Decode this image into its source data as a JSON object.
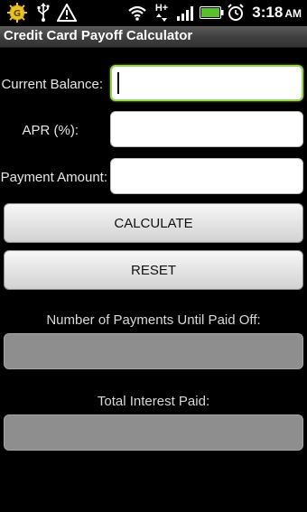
{
  "status_bar": {
    "time": "3:18",
    "ampm": "AM",
    "icons": [
      "htc-sense-icon",
      "usb-icon",
      "warning-icon",
      "wifi-icon",
      "hplus-data-icon",
      "signal-icon",
      "battery-icon",
      "alarm-icon"
    ],
    "data_type_label": "H+"
  },
  "app": {
    "title": "Credit Card Payoff Calculator"
  },
  "form": {
    "current_balance": {
      "label": "Current Balance:",
      "value": ""
    },
    "apr": {
      "label": "APR (%):",
      "value": ""
    },
    "payment_amount": {
      "label": "Payment Amount:",
      "value": ""
    }
  },
  "buttons": {
    "calculate": "CALCULATE",
    "reset": "RESET"
  },
  "results": {
    "payments_label": "Number of Payments Until Paid Off:",
    "payments_value": "",
    "interest_label": "Total Interest Paid:",
    "interest_value": ""
  },
  "colors": {
    "focus_border": "#9bd25a",
    "result_box": "#8e8e8e",
    "battery_green": "#58c02c"
  }
}
